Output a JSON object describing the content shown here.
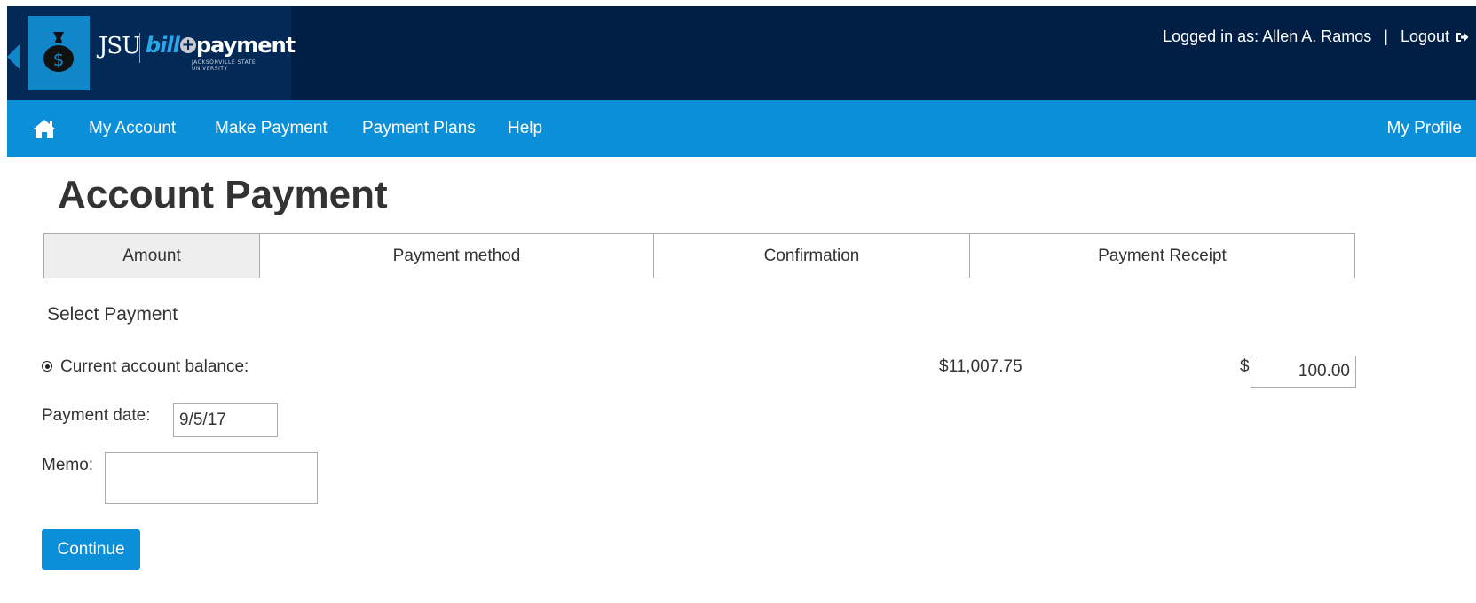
{
  "header": {
    "logo": {
      "school": "JSU",
      "brand_part1": "bill",
      "brand_plus": "+",
      "brand_part2": "payment",
      "subtitle": "JACKSONVILLE STATE UNIVERSITY"
    },
    "logged_in_text": "Logged in as: Allen A. Ramos",
    "separator": "|",
    "logout_label": "Logout",
    "icons": [
      "money-bag-icon",
      "logout-icon"
    ]
  },
  "nav": {
    "home_icon": "home-icon",
    "items": [
      "My Account",
      "Make Payment",
      "Payment Plans",
      "Help"
    ],
    "profile_label": "My Profile"
  },
  "main": {
    "title": "Account Payment",
    "steps": [
      {
        "label": "Amount",
        "active": true
      },
      {
        "label": "Payment method",
        "active": false
      },
      {
        "label": "Confirmation",
        "active": false
      },
      {
        "label": "Payment Receipt",
        "active": false
      }
    ],
    "section_title": "Select Payment",
    "balance_label": "Current account balance:",
    "balance_value": "$11,007.75",
    "currency_symbol": "$",
    "amount_value": "100.00",
    "payment_date_label": "Payment date:",
    "payment_date_value": "9/5/17",
    "memo_label": "Memo:",
    "memo_value": "",
    "continue_label": "Continue"
  },
  "colors": {
    "header_bg": "#011e44",
    "nav_bg": "#0b8fd9",
    "button_bg": "#0b8fd9",
    "logo_accent": "#1087c9"
  }
}
